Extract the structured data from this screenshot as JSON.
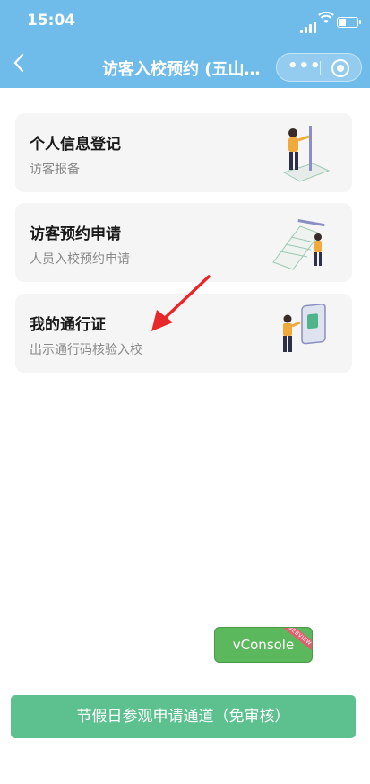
{
  "status_bar": {
    "time": "15:04"
  },
  "navbar": {
    "back_label": "<",
    "title": "访客入校预约 (五山…"
  },
  "menu": [
    {
      "title": "个人信息登记",
      "subtitle": "访客报备"
    },
    {
      "title": "访客预约申请",
      "subtitle": "人员入校预约申请"
    },
    {
      "title": "我的通行证",
      "subtitle": "出示通行码核验入校"
    }
  ],
  "vconsole": {
    "label": "vConsole",
    "ribbon": "WEBVIEW"
  },
  "bottom_button": {
    "label": "节假日参观申请通道（免审核）"
  },
  "colors": {
    "header": "#6fbbe9",
    "card": "#f5f5f5",
    "primary_button": "#5cc08f",
    "vconsole": "#5cb85c",
    "arrow": "#e8272a"
  }
}
